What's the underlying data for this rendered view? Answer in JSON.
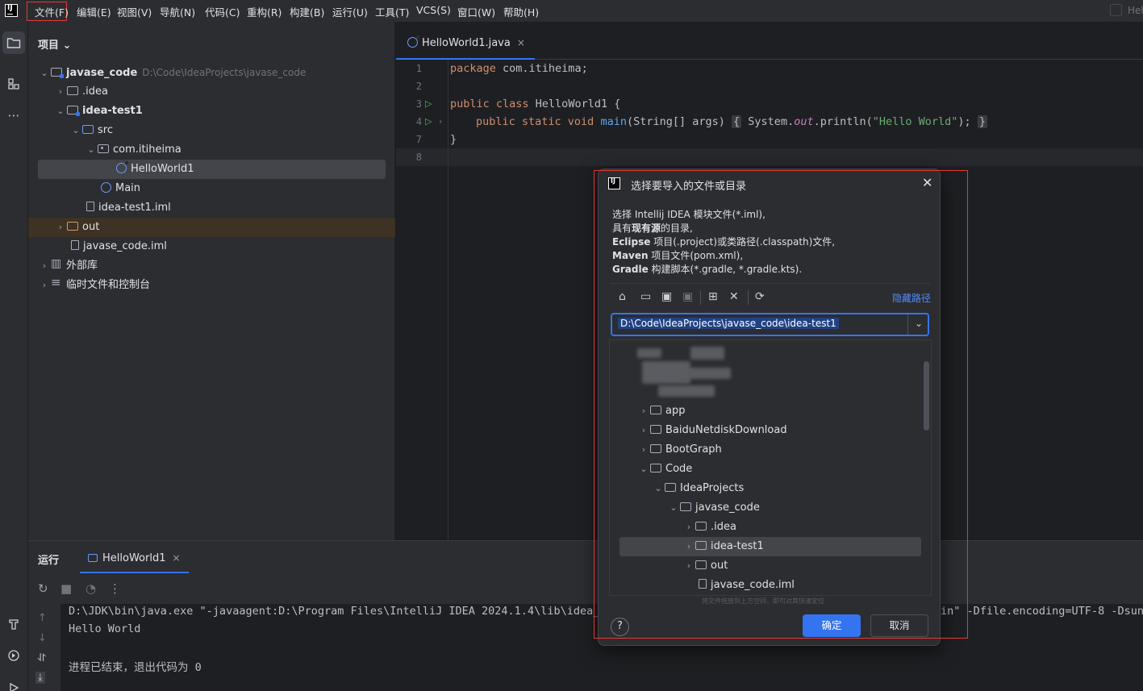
{
  "titlebar": {
    "logo_text": "IJ",
    "menu": [
      "文件(F)",
      "编辑(E)",
      "视图(V)",
      "导航(N)",
      "代码(C)",
      "重构(R)",
      "构建(B)",
      "运行(U)",
      "工具(T)",
      "VCS(S)",
      "窗口(W)",
      "帮助(H)"
    ],
    "right_text": "Hel"
  },
  "project": {
    "title": "项目 ⌄",
    "tree": [
      {
        "label": "javase_code",
        "hint": "D:\\Code\\IdeaProjects\\javase_code",
        "bold": true
      },
      {
        "label": ".idea"
      },
      {
        "label": "idea-test1",
        "bold": true
      },
      {
        "label": "src"
      },
      {
        "label": "com.itiheima"
      },
      {
        "label": "HelloWorld1"
      },
      {
        "label": "Main"
      },
      {
        "label": "idea-test1.iml"
      },
      {
        "label": "out"
      },
      {
        "label": "javase_code.iml"
      },
      {
        "label": "外部库"
      },
      {
        "label": "临时文件和控制台"
      }
    ]
  },
  "editor": {
    "tab_label": "HelloWorld1.java",
    "line_numbers": [
      "1",
      "2",
      "3",
      "4",
      "7",
      "8"
    ],
    "code": {
      "l1_kw": "package",
      "l1_rest": " com.itiheima;",
      "l3_kw": "public class",
      "l3_rest": " HelloWorld1 {",
      "l4_kw": "public static void",
      "l4_fn": "main",
      "l4_args": "(String[] args)",
      "l4_open": "{",
      "l4_sys": " System.",
      "l4_out": "out",
      "l4_call": ".println(",
      "l4_str": "\"Hello World\"",
      "l4_end": ");",
      "l4_close": "}",
      "l7": "}"
    }
  },
  "run": {
    "label": "运行",
    "tab_label": "HelloWorld1",
    "console": [
      "D:\\JDK\\bin\\java.exe \"-javaagent:D:\\Program Files\\IntelliJ IDEA 2024.1.4\\lib\\idea_r",
      "Hello World",
      "进程已结束，退出代码为 0"
    ],
    "console_right": "in\" -Dfile.encoding=UTF-8 -Dsun."
  },
  "dialog": {
    "logo_text": "IJ",
    "title": "选择要导入的文件或目录",
    "desc": {
      "l1": "选择 Intellij IDEA 模块文件(*.iml),",
      "l2_a": "具有",
      "l2_b": "现有源",
      "l2_c": "的目录,",
      "l3_a": "Eclipse",
      "l3_b": " 项目(.project)或类路径(.classpath)文件,",
      "l4_a": "Maven",
      "l4_b": " 项目文件(pom.xml),",
      "l5_a": "Gradle",
      "l5_b": " 构建脚本(*.gradle, *.gradle.kts)."
    },
    "hide_path": "隐藏路径",
    "path": "D:\\Code\\IdeaProjects\\javase_code\\idea-test1",
    "tree": [
      "app",
      "BaiduNetdiskDownload",
      "BootGraph",
      "Code",
      "IdeaProjects",
      "javase_code",
      ".idea",
      "idea-test1",
      "out",
      "javase_code.iml"
    ],
    "dnd_hint": "将文件拖放到上方空间，即可对其快速定位",
    "help": "?",
    "ok": "确定",
    "cancel": "取消"
  }
}
